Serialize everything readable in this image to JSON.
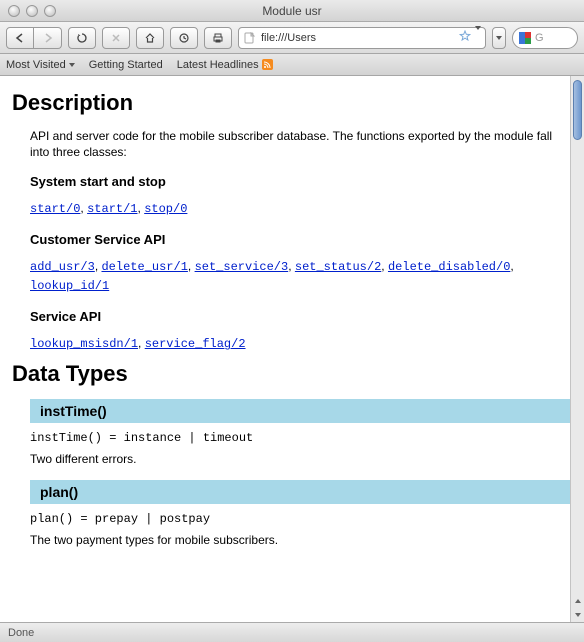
{
  "window": {
    "title": "Module usr"
  },
  "url": {
    "display": "file:///Users"
  },
  "search": {
    "placeholder": "G"
  },
  "bookmarks": {
    "most_visited": "Most Visited",
    "getting_started": "Getting Started",
    "latest_headlines": "Latest Headlines"
  },
  "page": {
    "h_description": "Description",
    "desc_text": "API and server code for the mobile subscriber database. The functions exported by the module fall into three classes:",
    "sub_system": "System start and stop",
    "links_system": [
      "start/0",
      "start/1",
      "stop/0"
    ],
    "sub_customer": "Customer Service API",
    "links_customer": [
      "add_usr/3",
      "delete_usr/1",
      "set_service/3",
      "set_status/2",
      "delete_disabled/0",
      "lookup_id/1"
    ],
    "sub_service": "Service API",
    "links_service": [
      "lookup_msisdn/1",
      "service_flag/2"
    ],
    "h_datatypes": "Data Types",
    "types": [
      {
        "name": "instTime()",
        "def": "instTime() = instance | timeout",
        "desc": "Two different errors."
      },
      {
        "name": "plan()",
        "def": "plan() = prepay | postpay",
        "desc": "The two payment types for mobile subscribers."
      }
    ]
  },
  "status": {
    "text": "Done"
  }
}
